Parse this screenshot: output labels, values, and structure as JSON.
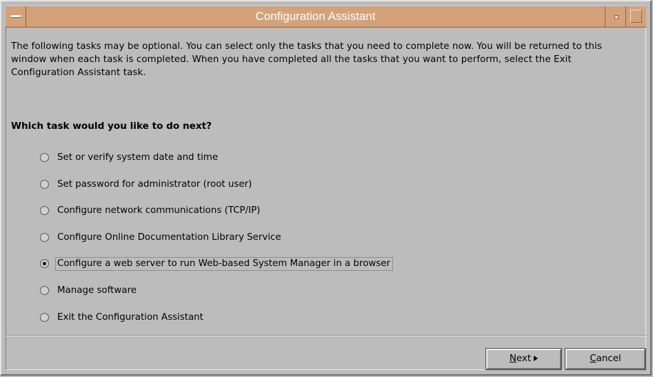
{
  "window": {
    "title": "Configuration Assistant"
  },
  "intro_text": "The following tasks may be optional.  You can select only the tasks that you need to complete now. You will be returned to this window when each task is completed.  When you have completed all the tasks that you want to perform, select the Exit Configuration Assistant task.",
  "question": "Which task would you like to do next?",
  "options": [
    {
      "label": "Set or verify system date and time",
      "checked": false
    },
    {
      "label": "Set password for administrator (root user)",
      "checked": false
    },
    {
      "label": "Configure network communications (TCP/IP)",
      "checked": false
    },
    {
      "label": "Configure Online Documentation Library Service",
      "checked": false
    },
    {
      "label": "Configure a web server to run Web-based System Manager in a browser",
      "checked": true
    },
    {
      "label": "Manage software",
      "checked": false
    },
    {
      "label": "Exit the Configuration Assistant",
      "checked": false
    }
  ],
  "buttons": {
    "next": {
      "mnemonic": "N",
      "rest": "ext"
    },
    "cancel": {
      "mnemonic": "C",
      "rest": "ancel"
    }
  },
  "colors": {
    "titlebar": "#d3a27b",
    "background": "#bcbcbc"
  }
}
